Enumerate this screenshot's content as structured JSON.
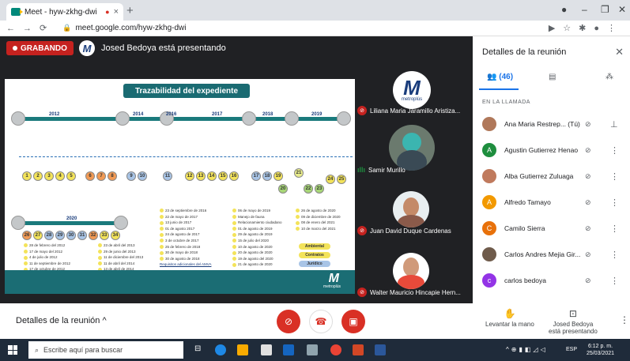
{
  "browser": {
    "tab_title": "Meet - hyw-zkhg-dwi",
    "url": "meet.google.com/hyw-zkhg-dwi"
  },
  "meet": {
    "recording_label": "GRABANDO",
    "presenter_logo": "M",
    "presenting_text": "Josed Bedoya está presentando"
  },
  "slide": {
    "title": "Trazabilidad del expediente",
    "years_top": [
      "2012",
      "2014",
      "2016",
      "2017",
      "2018",
      "2019"
    ],
    "year_bottom": "2020",
    "row1": [
      {
        "n": "1",
        "c": "y"
      },
      {
        "n": "2",
        "c": "y"
      },
      {
        "n": "3",
        "c": "y"
      },
      {
        "n": "4",
        "c": "y"
      },
      {
        "n": "5",
        "c": "y"
      },
      {
        "n": "6",
        "c": "o"
      },
      {
        "n": "7",
        "c": "o"
      },
      {
        "n": "8",
        "c": "o"
      },
      {
        "n": "9",
        "c": "b"
      },
      {
        "n": "10",
        "c": "b"
      },
      {
        "n": "11",
        "c": "b"
      },
      {
        "n": "12",
        "c": "y"
      },
      {
        "n": "13",
        "c": "y"
      },
      {
        "n": "14",
        "c": "y"
      },
      {
        "n": "15",
        "c": "y"
      },
      {
        "n": "16",
        "c": "y"
      },
      {
        "n": "17",
        "c": "b"
      },
      {
        "n": "18",
        "c": "b"
      },
      {
        "n": "19",
        "c": "y"
      },
      {
        "n": "20",
        "c": "g"
      },
      {
        "n": "21",
        "c": "c"
      },
      {
        "n": "22",
        "c": "g"
      },
      {
        "n": "23",
        "c": "g"
      },
      {
        "n": "24",
        "c": "y"
      },
      {
        "n": "25",
        "c": "y"
      }
    ],
    "row2": [
      {
        "n": "26",
        "c": "o"
      },
      {
        "n": "27",
        "c": "y"
      },
      {
        "n": "28",
        "c": "b"
      },
      {
        "n": "29",
        "c": "b"
      },
      {
        "n": "30",
        "c": "b"
      },
      {
        "n": "31",
        "c": "b"
      },
      {
        "n": "32",
        "c": "o"
      },
      {
        "n": "33",
        "c": "y"
      },
      {
        "n": "34",
        "c": "y"
      }
    ],
    "dates_col1": [
      "28 de febrero del 2012",
      "17 de mayo del 2012",
      "4 de julio de 2012",
      "11 de septiembre de 2012",
      "17 de octubre de 2012"
    ],
    "dates_col2": [
      "23 de abril del 2013",
      "29 de junio del 2013",
      "11 de diciembre del 2013",
      "11 de abril del 2014",
      "13 de abril de 2014"
    ],
    "dates_col3": [
      "23 de septiembre de 2016",
      "22 de mayo de 2017",
      "13 junio de 2017",
      "01 de agosto 2017",
      "24 de agosto de 2017",
      "3 de octubre de 2017",
      "25 de febrero de 2018",
      "30 de mayo de 2018",
      "30 de agosto de 2018"
    ],
    "dates_col3_link": "Requisitos adicionales del AMVA",
    "dates_col4": [
      "06 de mayo de 2019",
      "Manejo de fauna",
      "Relacionamiento ciudadano",
      "01 de agosto de 2019",
      "29 de agosto de 2019",
      "15 de julio del 2020",
      "10 de agosto de 2020",
      "20 de agosto de 2020",
      "19 de agosto del 2020",
      "21 de agosto de 2020"
    ],
    "dates_col5": [
      "26 de agosto de 2020",
      "09 de diciembre de 2020",
      "08 de enero del 2021",
      "10 de marzo del 2021"
    ],
    "legend": [
      "Ambiental",
      "Contratos",
      "Jurídico"
    ],
    "footer_logo": "M",
    "footer_sub": "metroplús"
  },
  "participants_tiles": [
    {
      "name": "Liliana Maria Jaramillo Aristiza...",
      "muted": true
    },
    {
      "name": "Samir Murillo",
      "muted": false
    },
    {
      "name": "Juan David Duque Cardenas",
      "muted": true
    },
    {
      "name": "Walter Mauricio Hincapie Hern...",
      "muted": true
    }
  ],
  "tile_logo": {
    "letter": "M",
    "sub": "metroplús"
  },
  "bottom": {
    "details_label": "Detalles de la reunión",
    "raise_hand": "Levantar la mano",
    "presenting_line1": "Josed Bedoya",
    "presenting_line2": "está presentando"
  },
  "panel": {
    "title": "Detalles de la reunión",
    "people_count": "(46)",
    "in_call": "EN LA LLAMADA",
    "people": [
      {
        "name": "Ana Maria Restrep...",
        "suffix": "(Tú)",
        "initial": "",
        "color": "#b0785a"
      },
      {
        "name": "Agustin Gutierrez Henao",
        "initial": "A",
        "color": "#1e8e3e"
      },
      {
        "name": "Alba Gutierrez Zuluaga",
        "initial": "",
        "color": "#c07a5d"
      },
      {
        "name": "Alfredo Tamayo",
        "initial": "A",
        "color": "#f29900"
      },
      {
        "name": "Camilo Sierra",
        "initial": "C",
        "color": "#e8710a"
      },
      {
        "name": "Carlos Andres Mejia Gir...",
        "initial": "",
        "color": "#6f5b4b"
      },
      {
        "name": "carlos bedoya",
        "initial": "c",
        "color": "#9334e6"
      }
    ]
  },
  "taskbar": {
    "search_placeholder": "Escribe aquí para buscar",
    "lang": "ESP",
    "time": "6:12 p. m.",
    "date": "25/03/2021"
  }
}
